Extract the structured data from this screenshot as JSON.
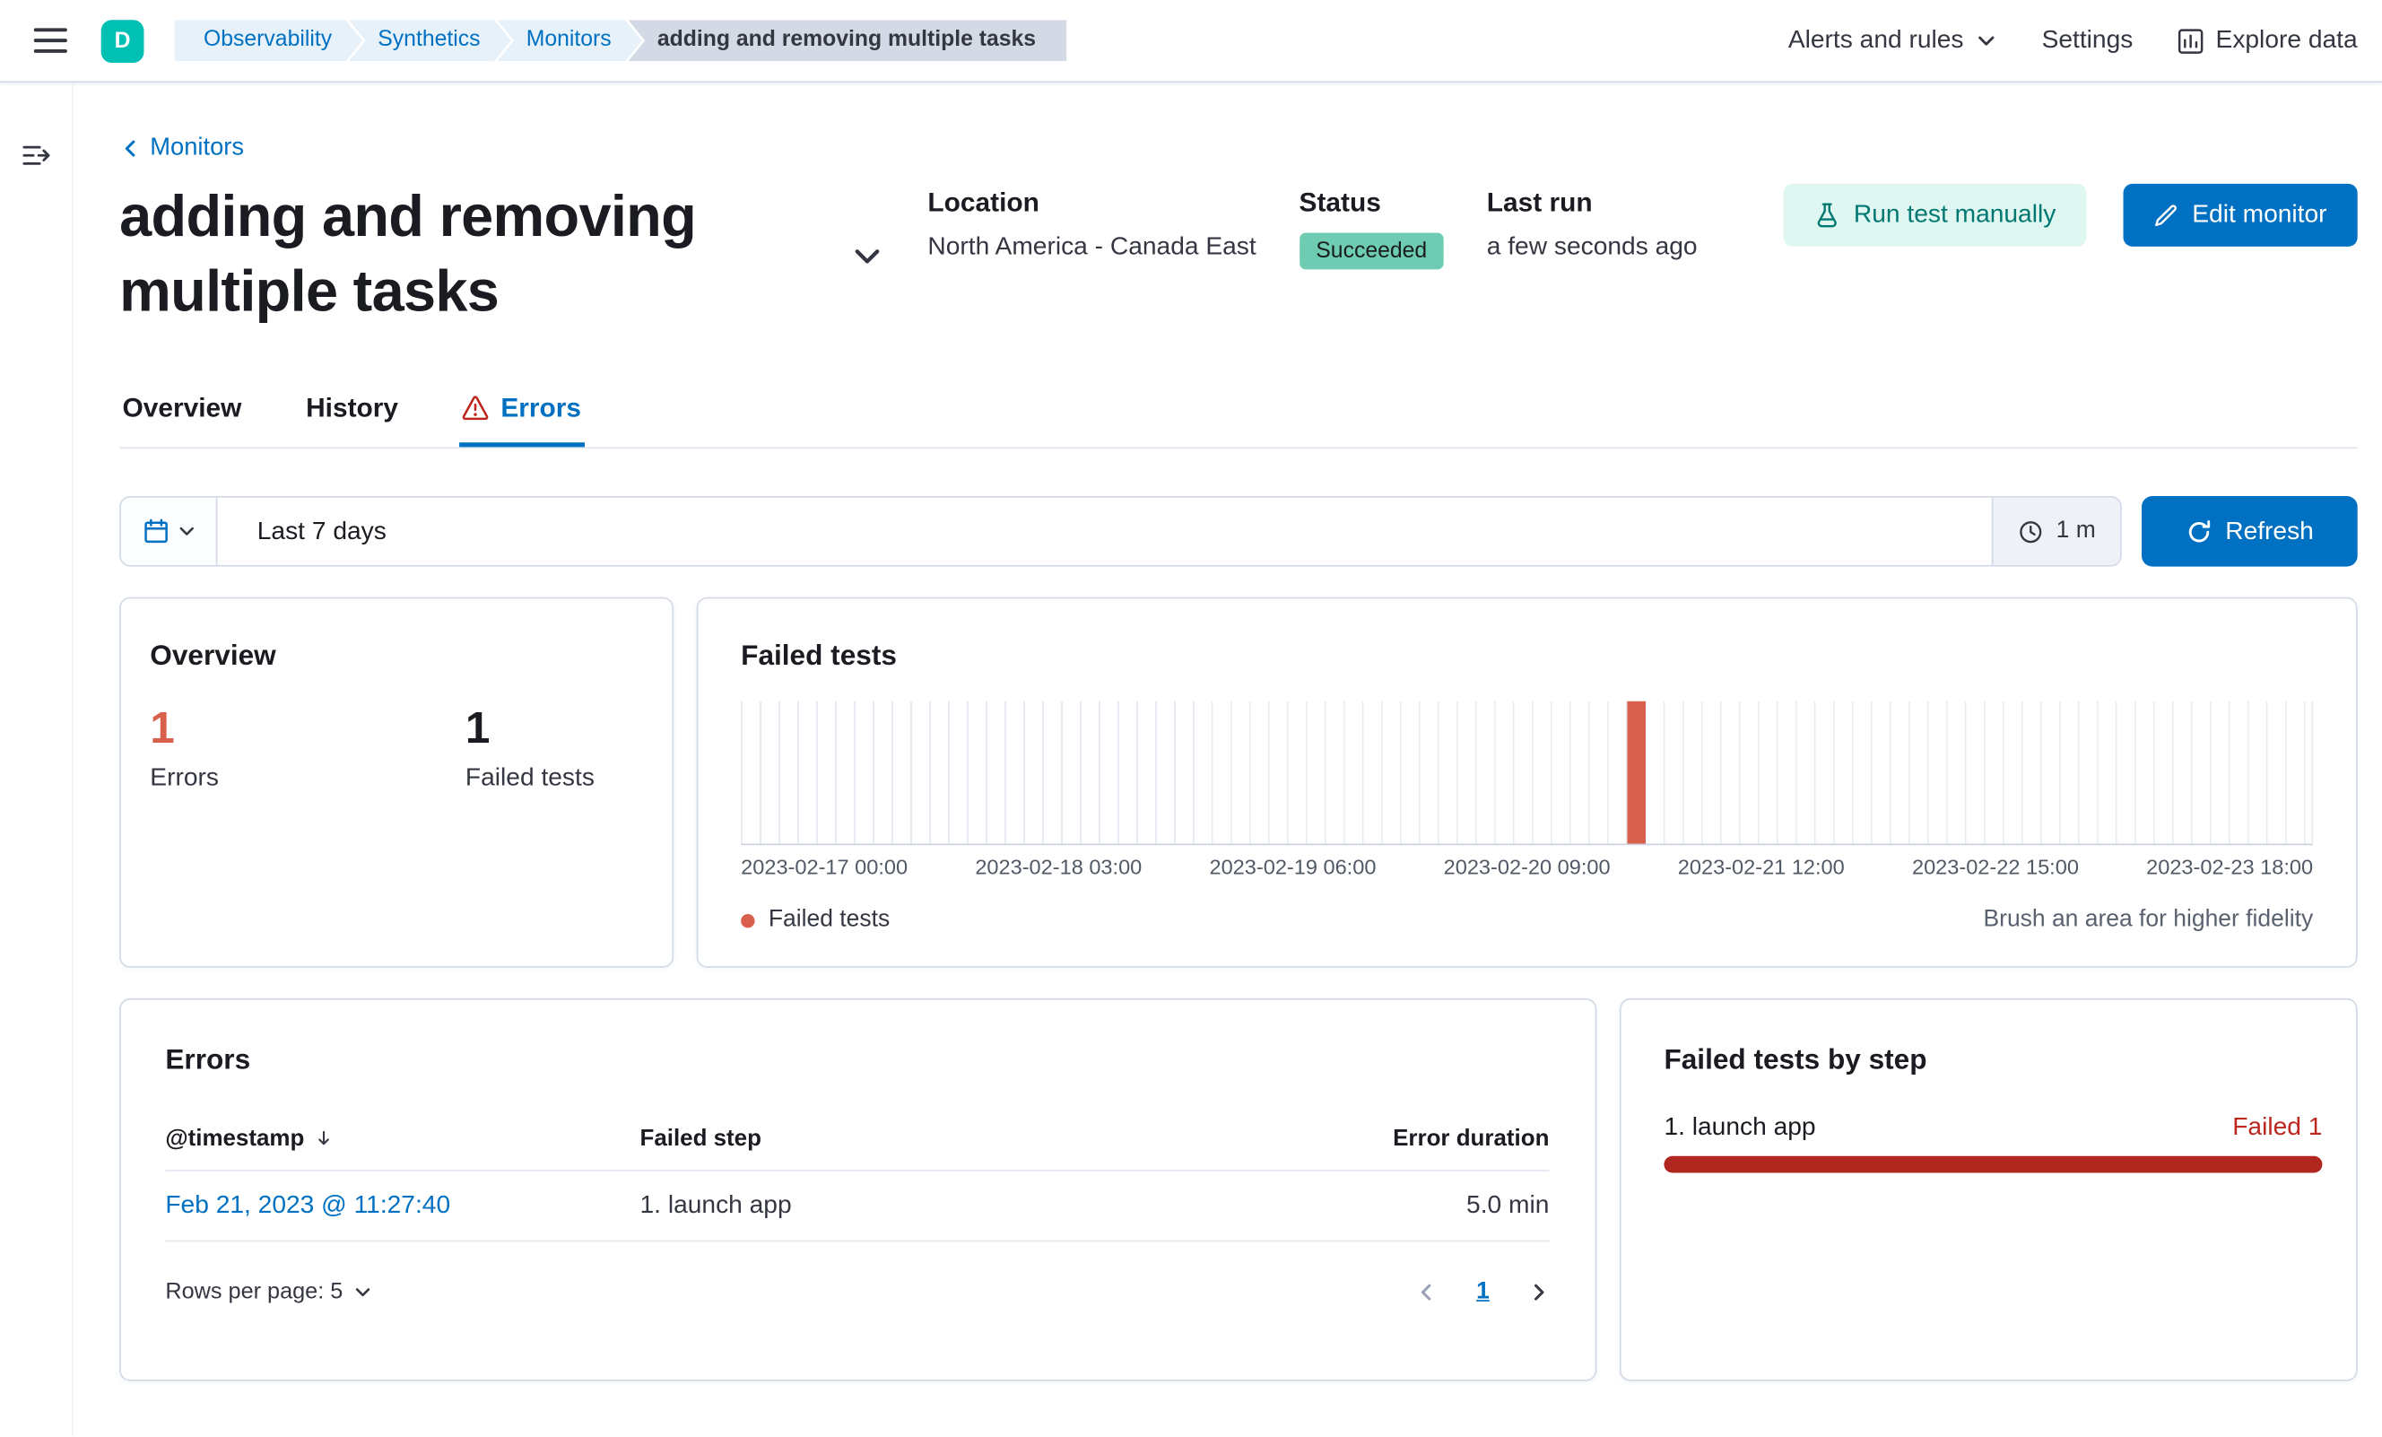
{
  "header": {
    "space_initial": "D",
    "breadcrumbs": [
      "Observability",
      "Synthetics",
      "Monitors",
      "adding and removing multiple tasks"
    ],
    "alerts_menu": "Alerts and rules",
    "settings": "Settings",
    "explore_data": "Explore data"
  },
  "page": {
    "back_link": "Monitors",
    "title": "adding and removing multiple tasks",
    "location_label": "Location",
    "location_value": "North America - Canada East",
    "status_label": "Status",
    "status_badge": "Succeeded",
    "last_run_label": "Last run",
    "last_run_value": "a few seconds ago",
    "run_test_button": "Run test manually",
    "edit_button": "Edit monitor",
    "tabs": [
      "Overview",
      "History",
      "Errors"
    ],
    "active_tab": "Errors"
  },
  "timebar": {
    "range": "Last 7 days",
    "refresh_interval": "1 m",
    "refresh_button": "Refresh"
  },
  "overview_panel": {
    "title": "Overview",
    "errors_count": "1",
    "errors_label": "Errors",
    "failed_tests_count": "1",
    "failed_tests_label": "Failed tests"
  },
  "failed_tests_panel": {
    "title": "Failed tests",
    "legend_label": "Failed tests",
    "brush_hint": "Brush an area for higher fidelity"
  },
  "chart_data": {
    "type": "bar",
    "title": "Failed tests",
    "x_tick_labels": [
      "2023-02-17 00:00",
      "2023-02-18 03:00",
      "2023-02-19 06:00",
      "2023-02-20 09:00",
      "2023-02-21 12:00",
      "2023-02-22 15:00",
      "2023-02-23 18:00"
    ],
    "x_range": [
      "2023-02-17 00:00",
      "2023-02-23 18:00"
    ],
    "ylim": [
      0,
      1
    ],
    "grid": "vertical gridlines, ~2h buckets over 7 days",
    "legend_position": "bottom-left",
    "series": [
      {
        "name": "Failed tests",
        "color": "#d9604c",
        "points": [
          {
            "x": "2023-02-21 11:00",
            "y": 1
          }
        ],
        "note": "single full-height red bar near 2023-02-21 11:00 (~56.4% across plot); all other buckets are 0"
      }
    ]
  },
  "errors_panel": {
    "title": "Errors",
    "columns": [
      "@timestamp",
      "Failed step",
      "Error duration"
    ],
    "sorted_by": "@timestamp descending",
    "rows": [
      {
        "timestamp": "Feb 21, 2023 @ 11:27:40",
        "failed_step": "1. launch app",
        "error_duration": "5.0 min"
      }
    ],
    "rows_per_page_label": "Rows per page: 5",
    "current_page": "1"
  },
  "failed_by_step_panel": {
    "title": "Failed tests by step",
    "steps": [
      {
        "label": "1. launch app",
        "result": "Failed 1",
        "fraction": 1.0
      }
    ]
  },
  "icons": {
    "menu-icon": "hamburger ≡",
    "expand-nav-icon": "lines with right arrow (expand side nav)",
    "chevron-down-icon": "⌄",
    "chevron-left-icon": "‹",
    "warning-icon": "red outlined triangle with !",
    "flask-icon": "test beaker",
    "pencil-icon": "✎",
    "calendar-icon": "calendar (quick select)",
    "refresh-clock-icon": "clock (auto refresh interval)",
    "refresh-icon": "↻ circular arrow",
    "sort-desc-icon": "↓",
    "explore-data-icon": "bar chart in frame",
    "legend-dot": "red dot"
  },
  "colors": {
    "primary_blue": "#0071c2",
    "link_blue": "#0071c2",
    "danger_red": "#bd271e",
    "step_bar_red": "#b1271f",
    "vis_red": "#d9604c",
    "success_badge_bg": "#6dccb1",
    "space_avatar_teal": "#00bfb3",
    "run_test_bg": "#e0f7f1",
    "run_test_text": "#007871",
    "breadcrumb_bg": "#e6f1fa",
    "breadcrumb_last_bg": "#d3dae6",
    "border_gray": "#d3dae6"
  }
}
